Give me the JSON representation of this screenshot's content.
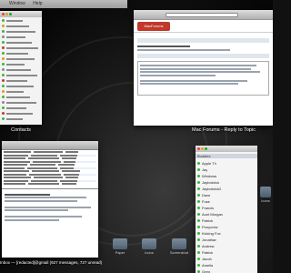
{
  "menubar": {
    "items": [
      "",
      "Window",
      "Help"
    ]
  },
  "windows": {
    "contacts": {
      "label": "Contacts"
    },
    "forum": {
      "label": "Mac Forums - Reply to Topic",
      "logo": "MacForums"
    },
    "mail": {
      "label": "Inbox — [redacted]@gmail (927 messages, 727 unread)"
    },
    "buddies": {
      "groups": [
        "Buddies"
      ],
      "names": [
        "Apple TV",
        "Jay",
        "Windows",
        "Jaybobrick",
        "Jaybobrick2",
        "Dave",
        "Fuse",
        "Francis",
        "Aunt Morgan",
        "Patrick",
        "Ponycrew",
        "Kicking Fox",
        "Jonathan",
        "Andrew",
        "Patrick",
        "Jacob",
        "Amelia",
        "Greg"
      ]
    }
  },
  "desktop_icons": [
    "Paper",
    "Icons",
    "Screenshot",
    "Icons"
  ],
  "colors": {
    "forum_brand": "#c0392b",
    "online": "#3fb536"
  }
}
